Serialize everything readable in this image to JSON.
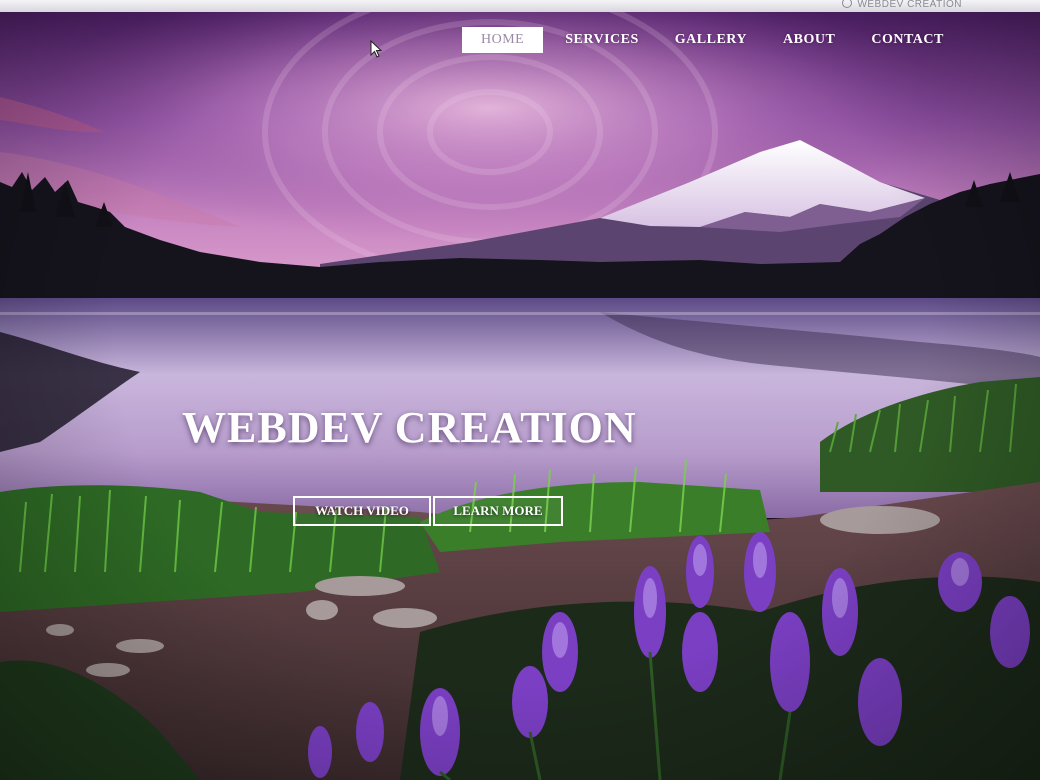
{
  "topbar": {
    "brand_label": "WEBDEV CREATION",
    "brand_icon": "check-circle-icon"
  },
  "nav": {
    "items": [
      {
        "label": "HOME",
        "active": true
      },
      {
        "label": "SERVICES",
        "active": false
      },
      {
        "label": "GALLERY",
        "active": false
      },
      {
        "label": "ABOUT",
        "active": false
      },
      {
        "label": "CONTACT",
        "active": false
      }
    ]
  },
  "hero": {
    "title": "WEBDEV CREATION",
    "buttons": {
      "watch_video": "WATCH VIDEO",
      "learn_more": "LEARN MORE"
    },
    "background": "mountain-lake-sunset-image"
  },
  "colors": {
    "sky_top": "#5b2a72",
    "sky_mid": "#c27ab8",
    "accent_white": "#ffffff",
    "active_nav_text": "#9a8aa6",
    "flowers": "#7b3fc4"
  }
}
